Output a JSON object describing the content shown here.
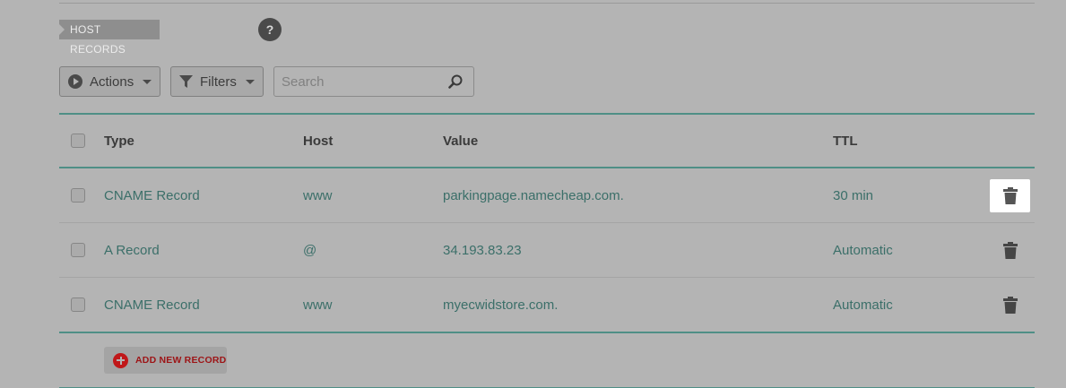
{
  "section": {
    "title": "HOST RECORDS",
    "help_label": "?"
  },
  "toolbar": {
    "actions_label": "Actions",
    "filters_label": "Filters",
    "search_placeholder": "Search",
    "search_value": ""
  },
  "table": {
    "columns": {
      "type": "Type",
      "host": "Host",
      "value": "Value",
      "ttl": "TTL"
    },
    "rows": [
      {
        "type": "CNAME Record",
        "host": "www",
        "value": "parkingpage.namecheap.com.",
        "ttl": "30 min",
        "delete_highlighted": true
      },
      {
        "type": "A Record",
        "host": "@",
        "value": "34.193.83.23",
        "ttl": "Automatic",
        "delete_highlighted": false
      },
      {
        "type": "CNAME Record",
        "host": "www",
        "value": "myecwidstore.com.",
        "ttl": "Automatic",
        "delete_highlighted": false
      }
    ]
  },
  "add_record": {
    "label": "ADD NEW RECORD"
  },
  "colors": {
    "accent_teal": "#4f8f86",
    "link_text": "#3b6f69",
    "add_red": "#c0181a",
    "overlay_bg": "#b4b4b4"
  },
  "icons": [
    "help-icon",
    "play-icon",
    "caret-down-icon",
    "funnel-icon",
    "search-icon",
    "trash-icon",
    "plus-icon"
  ]
}
